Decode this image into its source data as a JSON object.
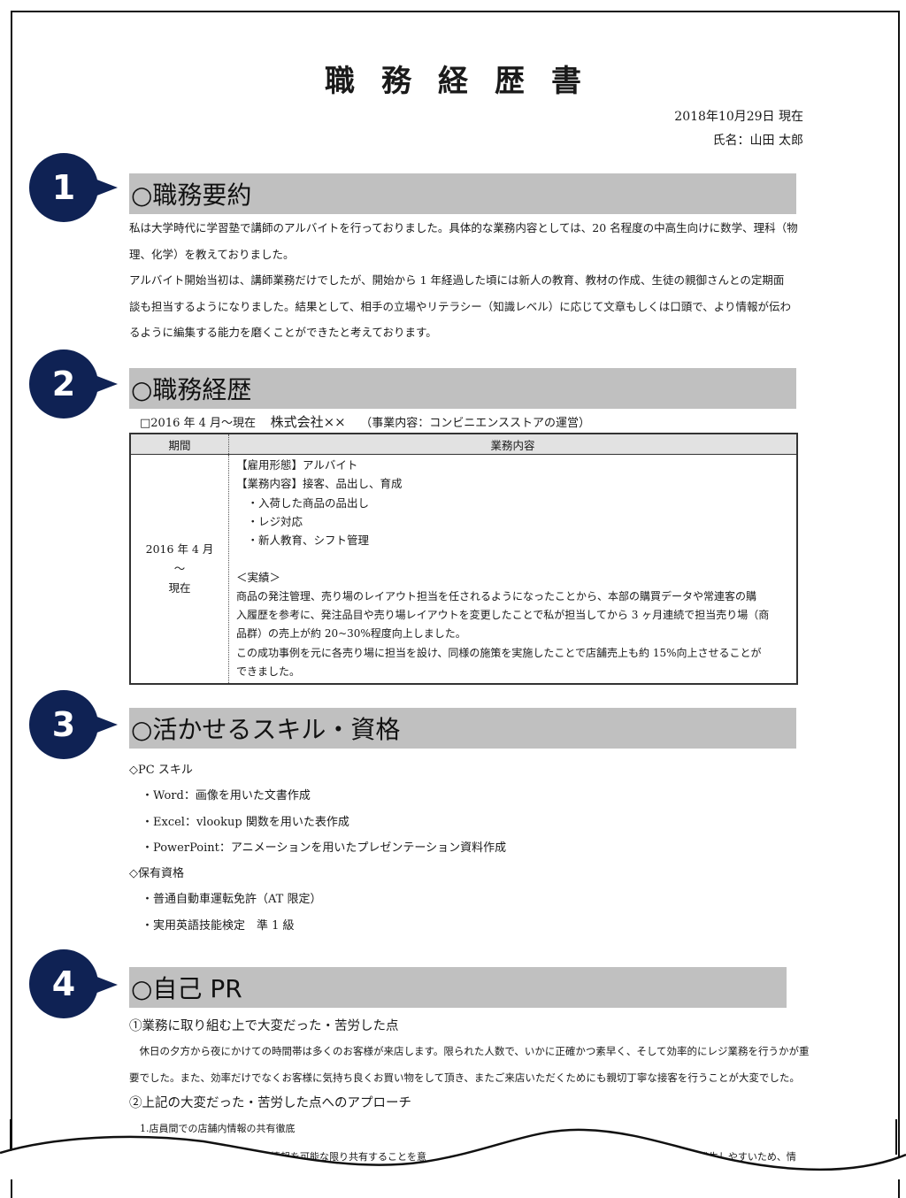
{
  "document": {
    "title": "職務経歴書",
    "date": "2018年10月29日 現在",
    "name": "氏名：山田 太郎"
  },
  "badge_color": "#0f2254",
  "header_bar_color": "#c0c0c0",
  "sections": [
    {
      "number": "1",
      "heading": "○職務要約",
      "paragraphs": [
        "私は大学時代に学習塾で講師のアルバイトを行っておりました。具体的な業務内容としては、20 名程度の中高生向けに数学、理科（物",
        "理、化学）を教えておりました。",
        "アルバイト開始当初は、講師業務だけでしたが、開始から 1 年経過した頃には新人の教育、教材の作成、生徒の親御さんとの定期面",
        "談も担当するようになりました。結果として、相手の立場やリテラシー（知識レベル）に応じて文章もしくは口頭で、より情報が伝わ",
        "るように編集する能力を磨くことができたと考えております。"
      ]
    },
    {
      "number": "2",
      "heading": "○職務経歴",
      "career_header": {
        "period": "□2016 年 4 月～現在",
        "company": "株式会社××",
        "business": "（事業内容：コンビニエンスストアの運営）"
      },
      "table": {
        "columns": [
          "期間",
          "業務内容"
        ],
        "rows": [
          {
            "period": [
              "2016 年 4 月",
              "～",
              "現在"
            ],
            "content": [
              "【雇用形態】アルバイト",
              "【業務内容】接客、品出し、育成",
              "　・入荷した商品の品出し",
              "　・レジ対応",
              "　・新人教育、シフト管理",
              "",
              "＜実績＞",
              "商品の発注管理、売り場のレイアウト担当を任されるようになったことから、本部の購買データや常連客の購",
              "入履歴を参考に、発注品目や売り場レイアウトを変更したことで私が担当してから 3 ヶ月連続で担当売り場（商",
              "品群）の売上が約 20~30%程度向上しました。",
              "この成功事例を元に各売り場に担当を設け、同様の施策を実施したことで店舗売上も約 15%向上させることが",
              "できました。"
            ]
          }
        ]
      }
    },
    {
      "number": "3",
      "heading": "○活かせるスキル・資格",
      "groups": [
        {
          "label": "◇PC スキル",
          "items": [
            "・Word：画像を用いた文書作成",
            "・Excel：vlookup 関数を用いた表作成",
            "・PowerPoint：アニメーションを用いたプレゼンテーション資料作成"
          ]
        },
        {
          "label": "◇保有資格",
          "items": [
            "・普通自動車運転免許（AT 限定）",
            "・実用英語技能検定　準 1 級"
          ]
        }
      ]
    },
    {
      "number": "4",
      "heading": "○自己 PR",
      "subsections": [
        {
          "heading": "①業務に取り組む上で大変だった・苦労した点",
          "lines": [
            "　休日の夕方から夜にかけての時間帯は多くのお客様が来店します。限られた人数で、いかに正確かつ素早く、そして効率的にレジ業務を行うかが重",
            "要でした。また、効率だけでなくお客様に気持ち良くお買い物をして頂き、またご来店いただくためにも親切丁寧な接客を行うことが大変でした。"
          ]
        },
        {
          "heading": "②上記の大変だった・苦労した点へのアプローチ",
          "lines": [
            "1.店員間での店舗内情報の共有徹底"
          ]
        }
      ],
      "cut_off_fragments": [
        "状況に関する情報を可能な限り共有することを意",
        "発生しやすいため、情"
      ]
    }
  ]
}
